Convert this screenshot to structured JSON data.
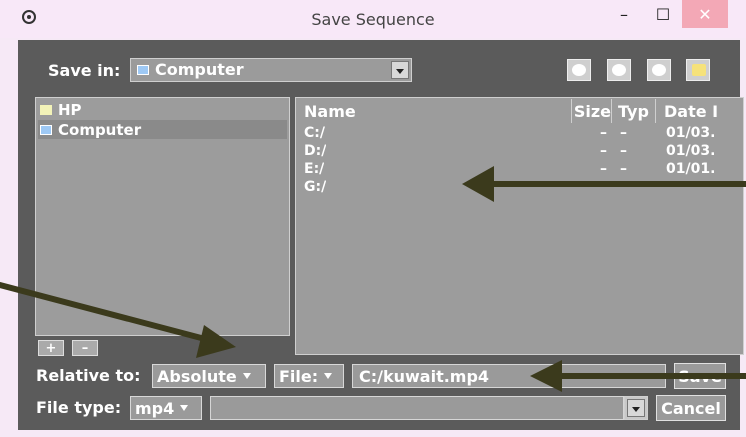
{
  "window": {
    "title": "Save Sequence",
    "minimize": "–",
    "maximize": "☐",
    "close": "✕"
  },
  "toolbar": {
    "save_in_label": "Save in:",
    "save_in_value": "Computer",
    "buttons": [
      "back-icon",
      "forward-icon",
      "up-icon",
      "new-folder-icon"
    ]
  },
  "sidebar": {
    "items": [
      {
        "label": "HP",
        "icon": "folder-icon"
      },
      {
        "label": "Computer",
        "icon": "computer-icon"
      }
    ],
    "add_label": "+",
    "remove_label": "–"
  },
  "file_list": {
    "headers": [
      "Name",
      "Size",
      "Typ",
      "Date I"
    ],
    "rows": [
      {
        "name": "C:/",
        "size": "–",
        "type": "–",
        "date": "01/03."
      },
      {
        "name": "D:/",
        "size": "–",
        "type": "–",
        "date": "01/03."
      },
      {
        "name": "E:/",
        "size": "–",
        "type": "–",
        "date": "01/01."
      },
      {
        "name": "G:/",
        "size": "",
        "type": "",
        "date": ""
      }
    ]
  },
  "bottom": {
    "relative_label": "Relative to:",
    "relative_value": "Absolute",
    "file_mode": "File:",
    "file_path": "C:/kuwait.mp4",
    "save_label": "Save",
    "file_type_label": "File type:",
    "file_type_value": "mp4",
    "cancel_label": "Cancel"
  },
  "colors": {
    "arrow": "#3b3a1c",
    "panel": "#9c9c9c",
    "window_bg": "#5b5b5b"
  }
}
